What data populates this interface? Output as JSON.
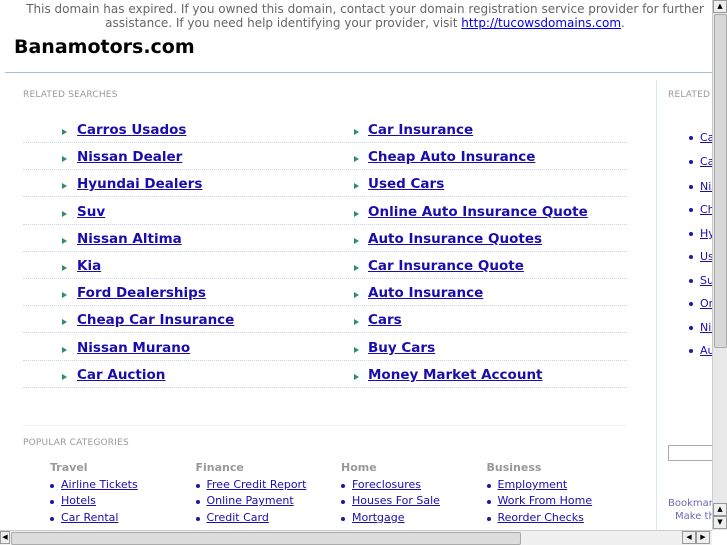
{
  "notice": {
    "text": "This domain has expired. If you owned this domain, contact your domain registration service provider for further assistance. If you need help identifying your provider, visit ",
    "link": "http://tucowsdomains.com",
    "end": "."
  },
  "site_title": "Banamotors.com",
  "related_label": "RELATED SEARCHES",
  "related_left": [
    "Carros Usados",
    "Nissan Dealer",
    "Hyundai Dealers",
    "Suv",
    "Nissan Altima",
    "Kia",
    "Ford Dealerships",
    "Cheap Car Insurance",
    "Nissan Murano",
    "Car Auction"
  ],
  "related_right": [
    "Car Insurance",
    "Cheap Auto Insurance",
    "Used Cars",
    "Online Auto Insurance Quote",
    "Auto Insurance Quotes",
    "Car Insurance Quote",
    "Auto Insurance",
    "Cars",
    "Buy Cars",
    "Money Market Account"
  ],
  "popular_label": "POPULAR CATEGORIES",
  "categories": [
    {
      "name": "Travel",
      "items": [
        "Airline Tickets",
        "Hotels",
        "Car Rental"
      ]
    },
    {
      "name": "Finance",
      "items": [
        "Free Credit Report",
        "Online Payment",
        "Credit Card"
      ]
    },
    {
      "name": "Home",
      "items": [
        "Foreclosures",
        "Houses For Sale",
        "Mortgage"
      ]
    },
    {
      "name": "Business",
      "items": [
        "Employment",
        "Work From Home",
        "Reorder Checks"
      ]
    }
  ],
  "side": {
    "label": "RELATED",
    "links": [
      "Ca",
      "Ca",
      "Nis",
      "Ch",
      "Hy",
      "Us",
      "Su",
      "On",
      "Nis",
      "Au"
    ],
    "bookmark": "Bookmark",
    "make": "Make thi"
  }
}
